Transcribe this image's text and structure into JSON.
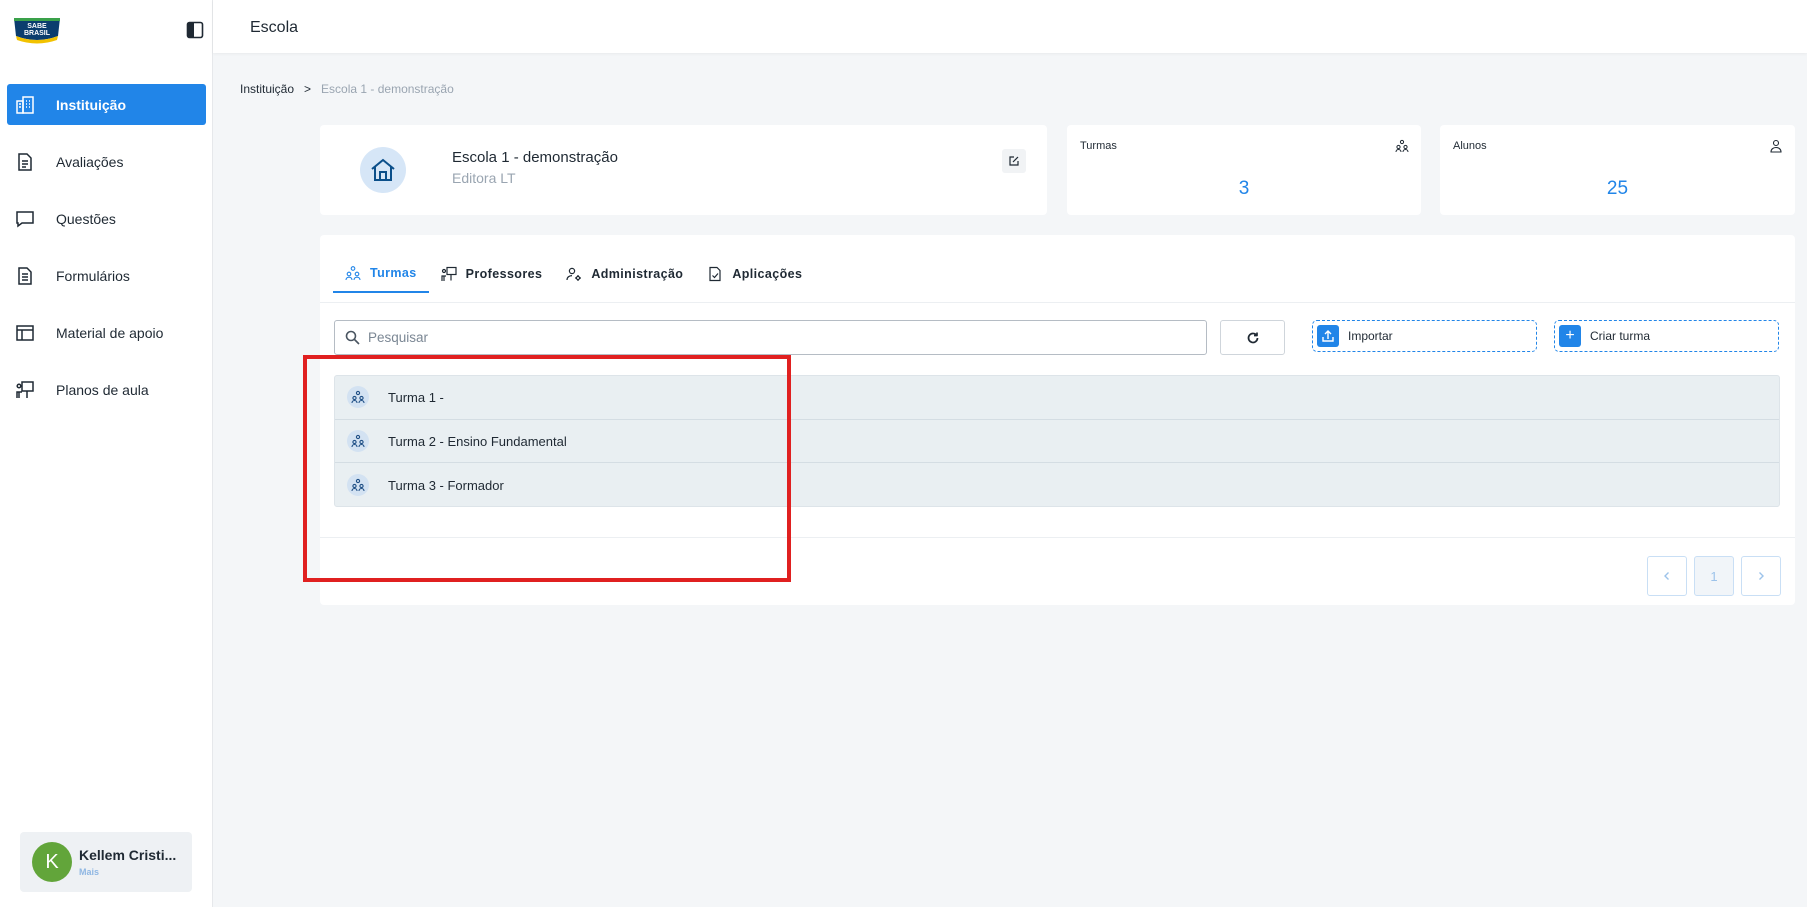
{
  "topbar": {
    "title": "Escola"
  },
  "brand": {
    "logo_text": "SABE BRASIL"
  },
  "sidebar": {
    "items": [
      {
        "label": "Instituição",
        "icon": "building-icon",
        "active": true
      },
      {
        "label": "Avaliações",
        "icon": "document-icon",
        "active": false
      },
      {
        "label": "Questões",
        "icon": "chat-icon",
        "active": false
      },
      {
        "label": "Formulários",
        "icon": "form-icon",
        "active": false
      },
      {
        "label": "Material de apoio",
        "icon": "layout-icon",
        "active": false
      },
      {
        "label": "Planos de aula",
        "icon": "presentation-icon",
        "active": false
      }
    ],
    "user": {
      "initial": "K",
      "name": "Kellem Cristi...",
      "more": "Mais"
    }
  },
  "breadcrumb": {
    "root": "Instituição",
    "separator": ">",
    "current": "Escola 1 - demonstração"
  },
  "school": {
    "name": "Escola 1 - demonstração",
    "subtitle": "Editora LT"
  },
  "stats": {
    "turmas": {
      "label": "Turmas",
      "value": "3"
    },
    "alunos": {
      "label": "Alunos",
      "value": "25"
    }
  },
  "tabs": [
    {
      "label": "Turmas",
      "active": true
    },
    {
      "label": "Professores",
      "active": false
    },
    {
      "label": "Administração",
      "active": false
    },
    {
      "label": "Aplicações",
      "active": false
    }
  ],
  "search": {
    "placeholder": "Pesquisar",
    "value": ""
  },
  "actions": {
    "import_label": "Importar",
    "create_label": "Criar turma"
  },
  "classes": [
    {
      "name": "Turma 1 -"
    },
    {
      "name": "Turma 2 - Ensino Fundamental"
    },
    {
      "name": "Turma 3 - Formador"
    }
  ],
  "pagination": {
    "current": "1"
  },
  "colors": {
    "accent": "#2185e8",
    "highlight": "#e02020",
    "avatar": "#62a53a"
  }
}
